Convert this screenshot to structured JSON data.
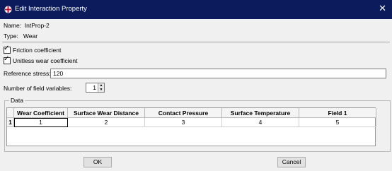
{
  "window": {
    "title": "Edit Interaction Property"
  },
  "info": {
    "name_label": "Name:",
    "name_value": "IntProp-2",
    "type_label": "Type:",
    "type_value": "Wear"
  },
  "options": {
    "friction_label": "Friction coefficient",
    "friction_checked": true,
    "unitless_label": "Unitless wear coefficient",
    "unitless_checked": true
  },
  "reference_stress": {
    "label": "Reference stress:",
    "value": "120"
  },
  "field_variables": {
    "label": "Number of field variables:",
    "value": "1"
  },
  "data_group": {
    "legend": "Data",
    "columns": [
      "Wear Coefficient",
      "Surface Wear Distance",
      "Contact Pressure",
      "Surface Temperature",
      "Field 1"
    ],
    "rows": [
      {
        "index": "1",
        "cells": [
          "1",
          "2",
          "3",
          "4",
          "5"
        ]
      }
    ]
  },
  "buttons": {
    "ok": "OK",
    "cancel": "Cancel"
  },
  "icons": {
    "app": "abaqus-cross-icon",
    "close": "close-icon"
  }
}
